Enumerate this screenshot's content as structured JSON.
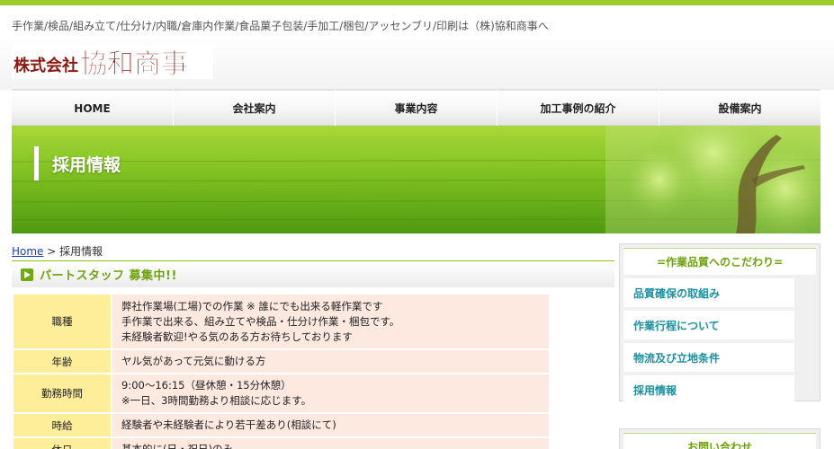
{
  "header": {
    "tagline": "手作業/検品/組み立て/仕分け/内職/倉庫内作業/食品菓子包装/手加工/梱包/アッセンブリ/印刷は（株)協和商事へ",
    "logo_text": "株式会社協和商事",
    "logo_prefix": "株式会社",
    "logo_name": "協和商事"
  },
  "nav": {
    "items": [
      {
        "label": "HOME"
      },
      {
        "label": "会社案内"
      },
      {
        "label": "事業内容"
      },
      {
        "label": "加工事例の紹介"
      },
      {
        "label": "設備案内"
      }
    ]
  },
  "banner": {
    "title": "採用情報"
  },
  "breadcrumb": {
    "home": "Home",
    "separator": " > ",
    "current": "採用情報"
  },
  "section": {
    "title": "パートスタッフ 募集中!!"
  },
  "jobs": {
    "rows": [
      {
        "label": "職種",
        "lines": [
          "弊社作業場(工場)での作業 ※ 誰にでも出来る軽作業です",
          "手作業で出来る、組み立てや検品・仕分け作業・梱包です。",
          "未経験者歓迎!やる気のある方お待ちしております"
        ]
      },
      {
        "label": "年齢",
        "lines": [
          "ヤル気があって元気に動ける方"
        ]
      },
      {
        "label": "勤務時間",
        "lines": [
          "9:00〜16:15（昼休憩・15分休憩）",
          "※一日、3時間勤務より相談に応じます。"
        ]
      },
      {
        "label": "時給",
        "lines": [
          "経験者や未経験者により若干差あり(相談にて)"
        ]
      },
      {
        "label": "休日",
        "lines": [
          "基本的に(日・祝日)のみ"
        ]
      }
    ]
  },
  "sidebar": {
    "heading": "=作業品質へのこだわり=",
    "links": [
      {
        "label": "品質確保の取組み"
      },
      {
        "label": "作業行程について"
      },
      {
        "label": "物流及び立地条件"
      },
      {
        "label": "採用情報"
      }
    ],
    "contact_heading": "お問い合わせ"
  },
  "colors": {
    "accent_green": "#8ec11c",
    "heading_green": "#6ea20c",
    "table_label_bg": "#ffee99",
    "table_cell_bg": "#fde9e0",
    "sidebar_link": "#1c8fa0"
  }
}
